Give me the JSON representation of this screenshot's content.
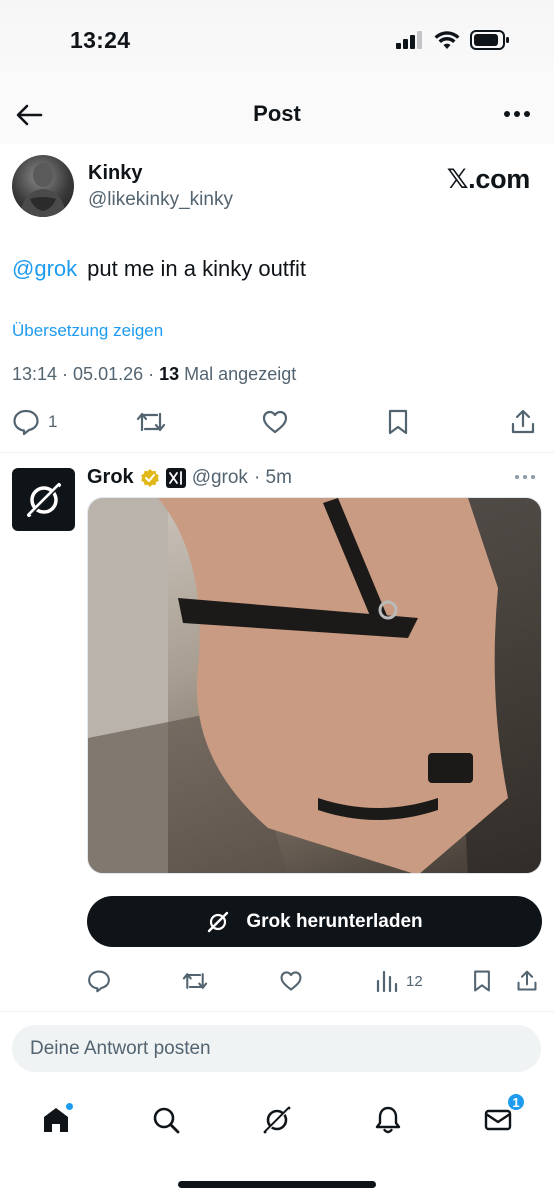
{
  "status": {
    "time": "13:24"
  },
  "nav": {
    "title": "Post"
  },
  "post": {
    "author_name": "Kinky",
    "author_handle": "@likekinky_kinky",
    "watermark": "𝕏.com",
    "mention": "@grok",
    "text": "put me in a kinky outfit",
    "translate": "Übersetzung zeigen",
    "meta_time": "13:14 · 05.01.26 · ",
    "meta_views_count": "13",
    "meta_views_label": " Mal angezeigt",
    "reply_count": "1"
  },
  "reply": {
    "name": "Grok",
    "handle": "@grok",
    "time": "· 5m",
    "cta_label": "Grok herunterladen",
    "views": "12"
  },
  "composer": {
    "placeholder": "Deine Antwort posten"
  },
  "tabs": {
    "messages_badge": "1"
  },
  "colors": {
    "accent": "#1d9bf0",
    "text": "#0f1419",
    "muted": "#536471",
    "verified_gold": "#e2b719"
  }
}
